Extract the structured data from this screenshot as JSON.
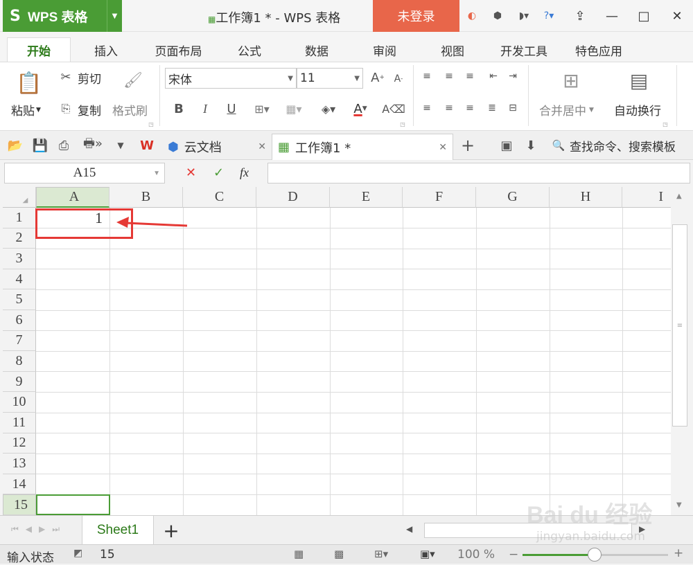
{
  "titlebar": {
    "app_name": "WPS 表格",
    "window_title": "工作簿1 * - WPS 表格",
    "login": "未登录"
  },
  "tabs": [
    "开始",
    "插入",
    "页面布局",
    "公式",
    "数据",
    "审阅",
    "视图",
    "开发工具",
    "特色应用"
  ],
  "ribbon": {
    "paste": "粘贴",
    "cut": "剪切",
    "copy": "复制",
    "format_painter": "格式刷",
    "font_name": "宋体",
    "font_size": "11",
    "bold": "B",
    "italic": "I",
    "underline": "U",
    "merge_center": "合并居中",
    "wrap_text": "自动换行"
  },
  "doctabs": {
    "cloud": "云文档",
    "workbook": "工作簿1 *",
    "search": "查找命令、搜索模板"
  },
  "formula": {
    "name_box": "A15",
    "cancel": "✕",
    "confirm": "✓",
    "fx": "fx",
    "value": ""
  },
  "columns": [
    "A",
    "B",
    "C",
    "D",
    "E",
    "F",
    "G",
    "H",
    "I"
  ],
  "rows": [
    "1",
    "2",
    "3",
    "4",
    "5",
    "6",
    "7",
    "8",
    "9",
    "10",
    "11",
    "12",
    "13",
    "14",
    "15"
  ],
  "cells": {
    "A1": "1"
  },
  "sheet": {
    "name": "Sheet1",
    "add": "+"
  },
  "status": {
    "mode": "输入状态",
    "count": "15",
    "zoom": "100 %"
  },
  "watermark": {
    "brand": "Bai du 经验",
    "url": "jingyan.baidu.com"
  },
  "colors": {
    "accent": "#4a9c35",
    "login": "#e8664a",
    "highlight": "#e53935"
  }
}
